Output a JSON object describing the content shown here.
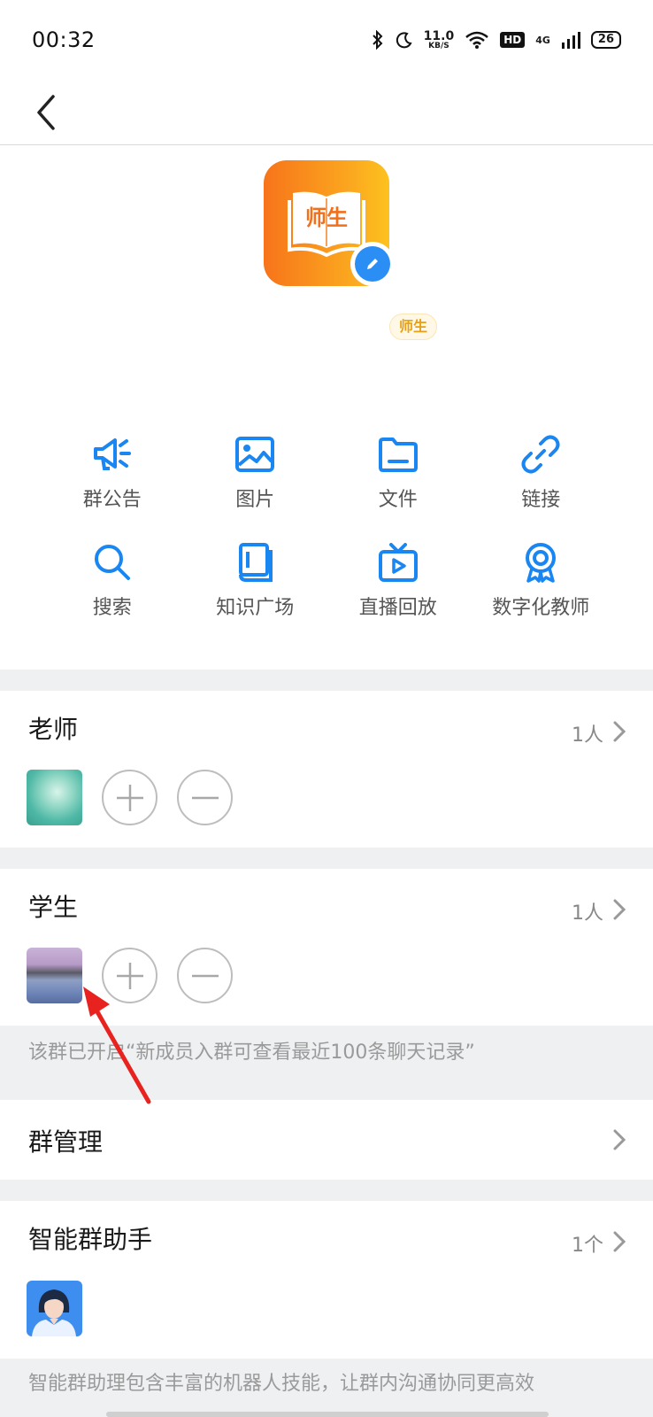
{
  "status_bar": {
    "time": "00:32",
    "speed_value": "11.0",
    "speed_unit": "KB/S",
    "hd": "HD",
    "network": "4G",
    "battery": "26"
  },
  "group": {
    "avatar_text": "师生",
    "tag": "师生",
    "brand_colors": [
      "#f7741a",
      "#fdc21f"
    ]
  },
  "tools": [
    {
      "label": "群公告",
      "icon": "megaphone-icon"
    },
    {
      "label": "图片",
      "icon": "image-icon"
    },
    {
      "label": "文件",
      "icon": "folder-icon"
    },
    {
      "label": "链接",
      "icon": "link-icon"
    },
    {
      "label": "搜索",
      "icon": "search-icon"
    },
    {
      "label": "知识广场",
      "icon": "book-icon"
    },
    {
      "label": "直播回放",
      "icon": "tv-play-icon"
    },
    {
      "label": "数字化教师",
      "icon": "badge-icon"
    }
  ],
  "teachers": {
    "title": "老师",
    "count": "1人"
  },
  "students": {
    "title": "学生",
    "count": "1人"
  },
  "history_notice": "该群已开启“新成员入群可查看最近100条聊天记录”",
  "group_manage": {
    "title": "群管理"
  },
  "assistant": {
    "title": "智能群助手",
    "count": "1个",
    "description": "智能群助理包含丰富的机器人技能，让群内沟通协同更高效"
  },
  "accent_color": "#1a86f2"
}
